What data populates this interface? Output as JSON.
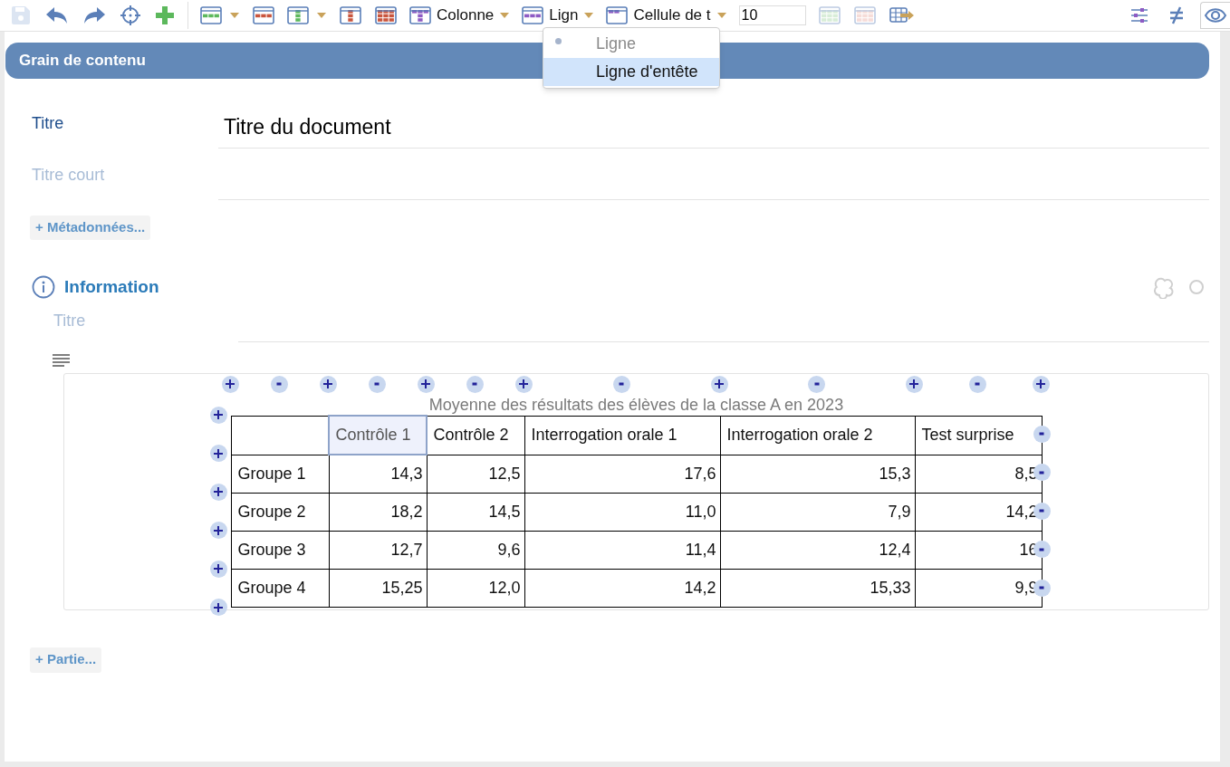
{
  "toolbar": {
    "items": [
      {
        "kind": "button",
        "disabled": true
      },
      {
        "kind": "button",
        "disabled": false
      },
      {
        "kind": "button",
        "disabled": false
      },
      {
        "kind": "button",
        "disabled": false
      },
      {
        "kind": "button",
        "disabled": false
      },
      {
        "kind": "separator"
      },
      {
        "kind": "dropdown",
        "disabled": false
      },
      {
        "kind": "button",
        "disabled": false
      },
      {
        "kind": "dropdown",
        "disabled": false
      },
      {
        "kind": "button",
        "disabled": false
      },
      {
        "kind": "button",
        "disabled": false
      },
      {
        "kind": "text_dropdown",
        "label": "Colonne",
        "disabled": false
      },
      {
        "kind": "text_dropdown",
        "label": "Lign",
        "disabled": false
      },
      {
        "kind": "text_dropdown",
        "label": "Cellule de t",
        "disabled": false
      },
      {
        "kind": "field",
        "value": "10"
      },
      {
        "kind": "button",
        "disabled": true
      },
      {
        "kind": "button",
        "disabled": true
      },
      {
        "kind": "button",
        "disabled": false
      }
    ],
    "right_items": [
      {
        "on": false
      },
      {
        "on": false
      },
      {
        "on": true
      }
    ]
  },
  "menu": {
    "items": [
      {
        "label": "Ligne",
        "selected": true,
        "highlighted": false,
        "disabled": true
      },
      {
        "label": "Ligne d'entête",
        "selected": false,
        "highlighted": true,
        "disabled": false
      }
    ]
  },
  "header": {
    "title": "Grain de contenu"
  },
  "fields": [
    {
      "label": "Titre",
      "value": "Titre du document"
    },
    {
      "label": "Titre court"
    }
  ],
  "metadata_button": "+ Métadonnées...",
  "section": {
    "title": "Information",
    "title_placeholder": "Titre",
    "table": {
      "caption": "Moyenne des résultats des élèves de la classe A en 2023",
      "columns": [
        {
          "label": "Contrôle 1",
          "selected": true
        },
        {
          "label": "Contrôle 2",
          "selected": false
        },
        {
          "label": "Interrogation orale 1",
          "selected": false
        },
        {
          "label": "Interrogation orale 2",
          "selected": false
        },
        {
          "label": "Test surprise",
          "selected": false
        }
      ],
      "rows": [
        {
          "label": "Groupe 1",
          "cells": [
            "14,3",
            "12,5",
            "17,6",
            "15,3",
            "8,5"
          ]
        },
        {
          "label": "Groupe 2",
          "cells": [
            "18,2",
            "14,5",
            "11,0",
            "7,9",
            "14,2"
          ]
        },
        {
          "label": "Groupe 3",
          "cells": [
            "12,7",
            "9,6",
            "11,4",
            "12,4",
            "16"
          ]
        },
        {
          "label": "Groupe 4",
          "cells": [
            "15,25",
            "12,0",
            "14,2",
            "15,33",
            "9,9"
          ]
        }
      ]
    }
  },
  "add_part_button": "+ Partie..."
}
